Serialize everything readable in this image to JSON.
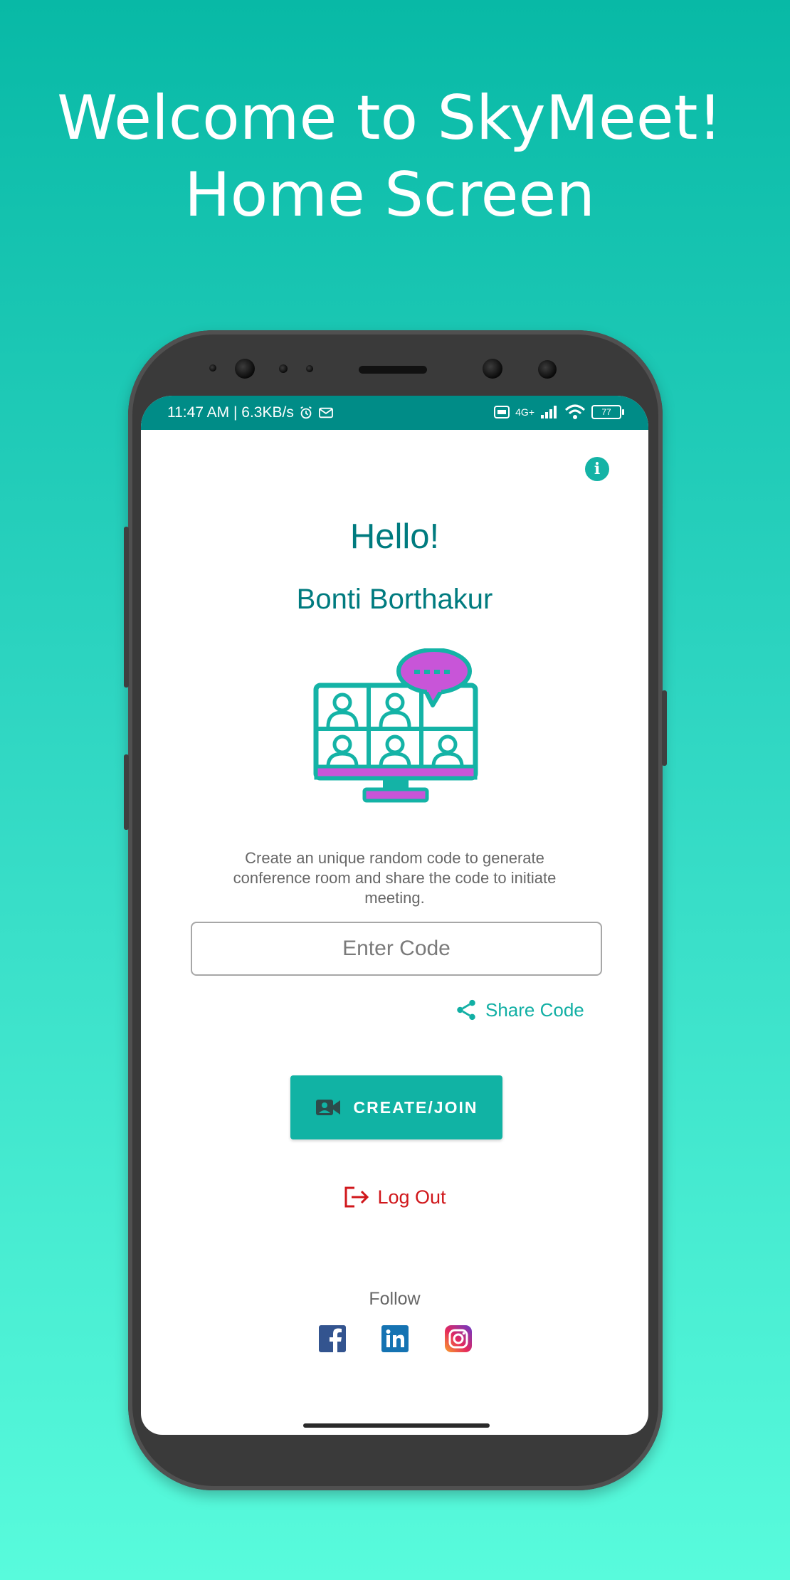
{
  "promo": {
    "title_line1": "Welcome to SkyMeet!",
    "title_line2": "Home Screen"
  },
  "status_bar": {
    "time_speed": "11:47 AM | 6.3KB/s",
    "network": "4G+",
    "battery": "77"
  },
  "main": {
    "greeting": "Hello!",
    "username": "Bonti Borthakur",
    "description": "Create an unique random code to generate conference room and share the code to initiate meeting.",
    "code_input_placeholder": "Enter Code",
    "share_code_label": "Share Code",
    "create_join_label": "CREATE/JOIN",
    "logout_label": "Log Out",
    "follow_label": "Follow"
  },
  "icons": {
    "info": "info-icon",
    "illustration": "video-conference-icon",
    "share": "share-icon",
    "camera": "video-camera-icon",
    "logout": "logout-icon",
    "facebook": "facebook-icon",
    "linkedin": "linkedin-icon",
    "instagram": "instagram-icon"
  },
  "colors": {
    "accent": "#11b3a4",
    "status_bar": "#008c87",
    "title_text": "#007b7f",
    "logout": "#d0171b",
    "illustration_purple": "#c855d8"
  }
}
